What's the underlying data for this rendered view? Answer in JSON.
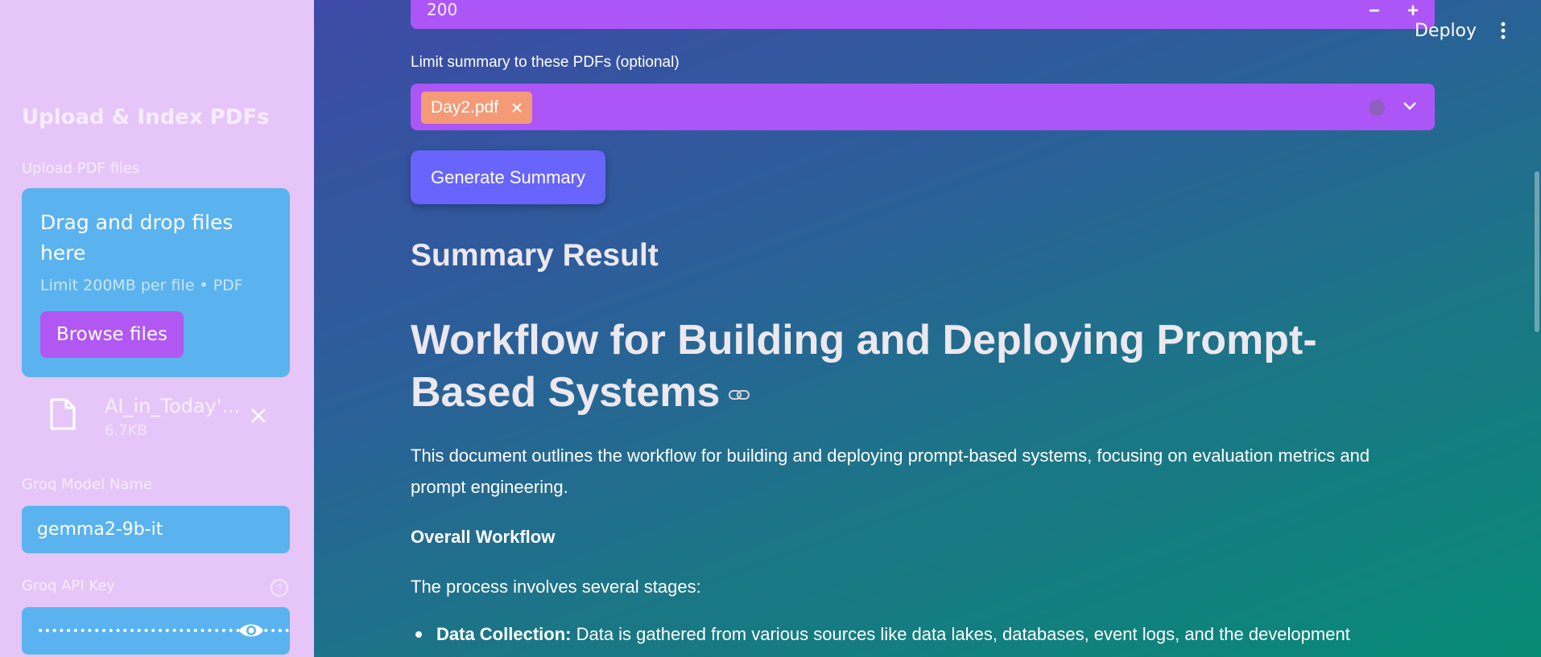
{
  "sidebar": {
    "title": "Upload & Index PDFs",
    "upload_label": "Upload PDF files",
    "dropzone": {
      "title": "Drag and drop files here",
      "limit": "Limit 200MB per file • PDF",
      "browse_label": "Browse files"
    },
    "uploaded_file": {
      "name": "AI_in_Today'...",
      "size": "6.7KB"
    },
    "model_label": "Groq Model Name",
    "model_value": "gemma2-9b-it",
    "api_key_label": "Groq API Key",
    "api_key_value": "••••••••••••••••••••••••••••••••••••"
  },
  "main": {
    "number_input_value": "200",
    "deploy_label": "Deploy",
    "limit_label": "Limit summary to these PDFs (optional)",
    "selected_pdf": "Day2.pdf",
    "generate_label": "Generate Summary",
    "summary_heading": "Summary Result",
    "doc_title": "Workflow for Building and Deploying Prompt-Based Systems",
    "intro": "This document outlines the workflow for building and deploying prompt-based systems, focusing on evaluation metrics and prompt engineering.",
    "overall_heading": "Overall Workflow",
    "stages_text": "The process involves several stages:",
    "bullet_label": "Data Collection:",
    "bullet_text": " Data is gathered from various sources like data lakes, databases, event logs, and the development"
  },
  "colors": {
    "sidebar_bg": "#e6c6f9",
    "sidebar_input": "#5ab3ee",
    "accent_purple": "#ac56f7",
    "button_blue": "#6964fb",
    "tag_orange": "#f49a76"
  },
  "icons": [
    "file-icon",
    "close-icon",
    "help-icon",
    "eye-icon",
    "minus-icon",
    "plus-icon",
    "kebab-menu-icon",
    "tag-remove-icon",
    "clear-icon",
    "chevron-down-icon",
    "link-icon"
  ]
}
